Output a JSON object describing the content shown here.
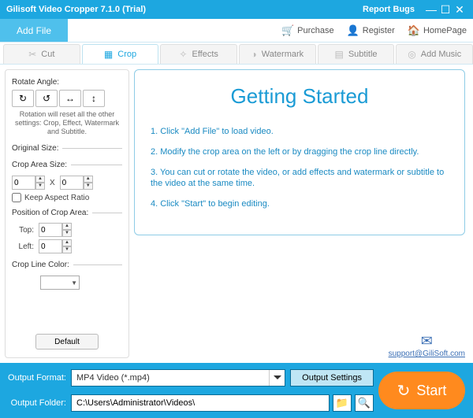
{
  "titlebar": {
    "title": "Gilisoft Video Cropper 7.1.0 (Trial)",
    "report": "Report Bugs"
  },
  "toolbar": {
    "addfile": "Add File",
    "purchase": "Purchase",
    "register": "Register",
    "homepage": "HomePage"
  },
  "tabs": {
    "cut": "Cut",
    "crop": "Crop",
    "effects": "Effects",
    "watermark": "Watermark",
    "subtitle": "Subtitle",
    "addmusic": "Add Music"
  },
  "side": {
    "rotate_legend": "Rotate Angle:",
    "note": "Rotation will reset all the other settings: Crop, Effect, Watermark and Subtitle.",
    "orig_legend": "Original Size:",
    "crop_legend": "Crop Area Size:",
    "crop_w": "0",
    "crop_h": "0",
    "x": "X",
    "keep": "Keep Aspect Ratio",
    "pos_legend": "Position of Crop Area:",
    "top_label": "Top:",
    "top_val": "0",
    "left_label": "Left:",
    "left_val": "0",
    "color_legend": "Crop Line Color:",
    "default": "Default"
  },
  "gs": {
    "title": "Getting Started",
    "s1": "1. Click \"Add File\" to load video.",
    "s2": "2. Modify the crop area on the left or by dragging the crop line directly.",
    "s3": "3. You can cut or rotate the video, or add effects and watermark or subtitle to the video at the same time.",
    "s4": "4. Click \"Start\" to begin editing.",
    "support": "support@GiliSoft.com"
  },
  "bottom": {
    "format_label": "Output Format:",
    "format_value": "MP4 Video (*.mp4)",
    "settings": "Output Settings",
    "folder_label": "Output Folder:",
    "folder_value": "C:\\Users\\Administrator\\Videos\\",
    "start": "Start"
  }
}
